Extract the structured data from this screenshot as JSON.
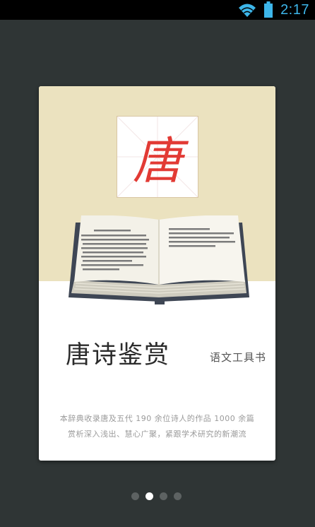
{
  "status_bar": {
    "time": "2:17",
    "icons": [
      "wifi-icon",
      "battery-icon"
    ],
    "accent_color": "#3db6ea"
  },
  "splash": {
    "seal_char": "唐",
    "seal_color": "#e23a34",
    "title": "唐诗鉴赏",
    "subtitle": "语文工具书",
    "description_line1": "本辞典收录唐及五代 190 余位诗人的作品 1000 余篇",
    "description_line2": "赏析深入浅出、慧心广聚，紧跟学术研究的新潮流",
    "top_background": "#ebe2bf"
  },
  "pager": {
    "count": 4,
    "active_index": 1
  }
}
